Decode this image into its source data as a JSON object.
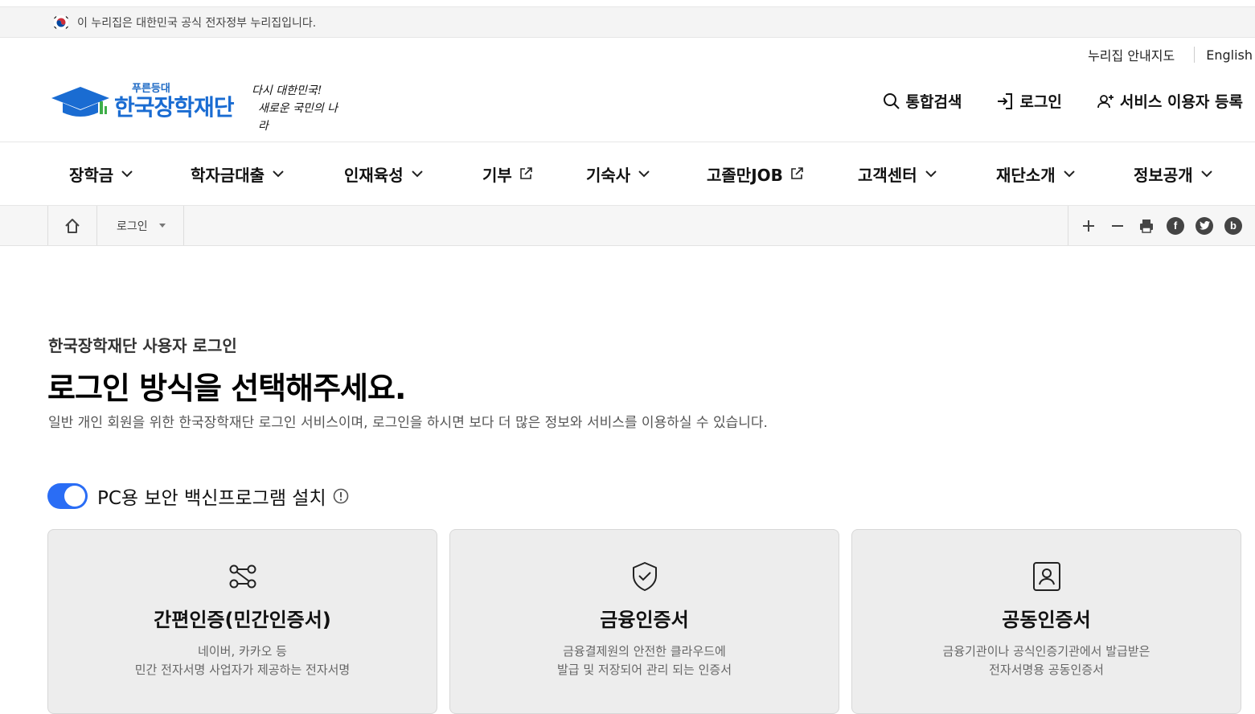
{
  "gov_banner": {
    "text": "이 누리집은 대한민국 공식 전자정부 누리집입니다."
  },
  "util_links": {
    "sitemap": "누리집 안내지도",
    "english": "English"
  },
  "logo": {
    "sub": "푸른등대",
    "main": "한국장학재단"
  },
  "slogan": {
    "line1": "다시 대한민국!",
    "line2": "새로운 국민의 나라"
  },
  "header_actions": {
    "search": "통합검색",
    "login": "로그인",
    "register": "서비스 이용자 등록"
  },
  "gnb": [
    {
      "label": "장학금",
      "icon": "chevron-down-icon"
    },
    {
      "label": "학자금대출",
      "icon": "chevron-down-icon"
    },
    {
      "label": "인재육성",
      "icon": "chevron-down-icon"
    },
    {
      "label": "기부",
      "icon": "external-link-icon"
    },
    {
      "label": "기숙사",
      "icon": "chevron-down-icon"
    },
    {
      "label": "고졸만JOB",
      "icon": "external-link-icon"
    },
    {
      "label": "고객센터",
      "icon": "chevron-down-icon"
    },
    {
      "label": "재단소개",
      "icon": "chevron-down-icon"
    },
    {
      "label": "정보공개",
      "icon": "chevron-down-icon"
    }
  ],
  "breadcrumb": {
    "current": "로그인"
  },
  "tools": {
    "facebook": "f",
    "blog": "b"
  },
  "page": {
    "subtitle": "한국장학재단 사용자 로그인",
    "title": "로그인 방식을 선택해주세요.",
    "description": "일반 개인 회원을 위한 한국장학재단 로그인 서비스이며, 로그인을 하시면 보다 더 많은 정보와 서비스를 이용하실 수 있습니다."
  },
  "security_toggle": {
    "label": "PC용 보안 백신프로그램 설치",
    "enabled": true
  },
  "cards": [
    {
      "title": "간편인증(민간인증서)",
      "desc1": "네이버, 카카오 등",
      "desc2": "민간 전자서명 사업자가 제공하는 전자서명",
      "icon": "connection-icon"
    },
    {
      "title": "금융인증서",
      "desc1": "금융결제원의 안전한 클라우드에",
      "desc2": "발급 및 저장되어 관리 되는 인증서",
      "icon": "shield-check-icon"
    },
    {
      "title": "공동인증서",
      "desc1": "금융기관이나 공식인증기관에서 발급받은",
      "desc2": "전자서명용 공동인증서",
      "icon": "id-card-icon"
    }
  ],
  "colors": {
    "brand": "#1a6cd2",
    "toggle": "#2a6df5"
  }
}
